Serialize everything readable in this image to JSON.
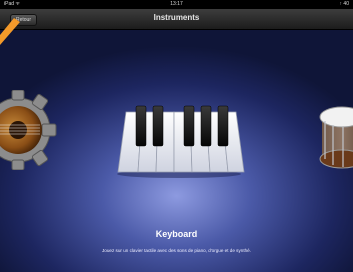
{
  "status_bar": {
    "carrier": "iPad ᯤ",
    "time": "13:17",
    "battery": "↑ 40"
  },
  "nav": {
    "title": "Instruments",
    "back_label": "Retour"
  },
  "instrument": {
    "name": "Keyboard",
    "description": "Jouez sur un clavier tactile avec des sons de piano, d'orgue et de synthé."
  },
  "colors": {
    "background": "#2a3580",
    "arrow": "#f39a2a"
  },
  "icons": [
    "guitar-icon",
    "keyboard-icon",
    "drum-icon"
  ]
}
